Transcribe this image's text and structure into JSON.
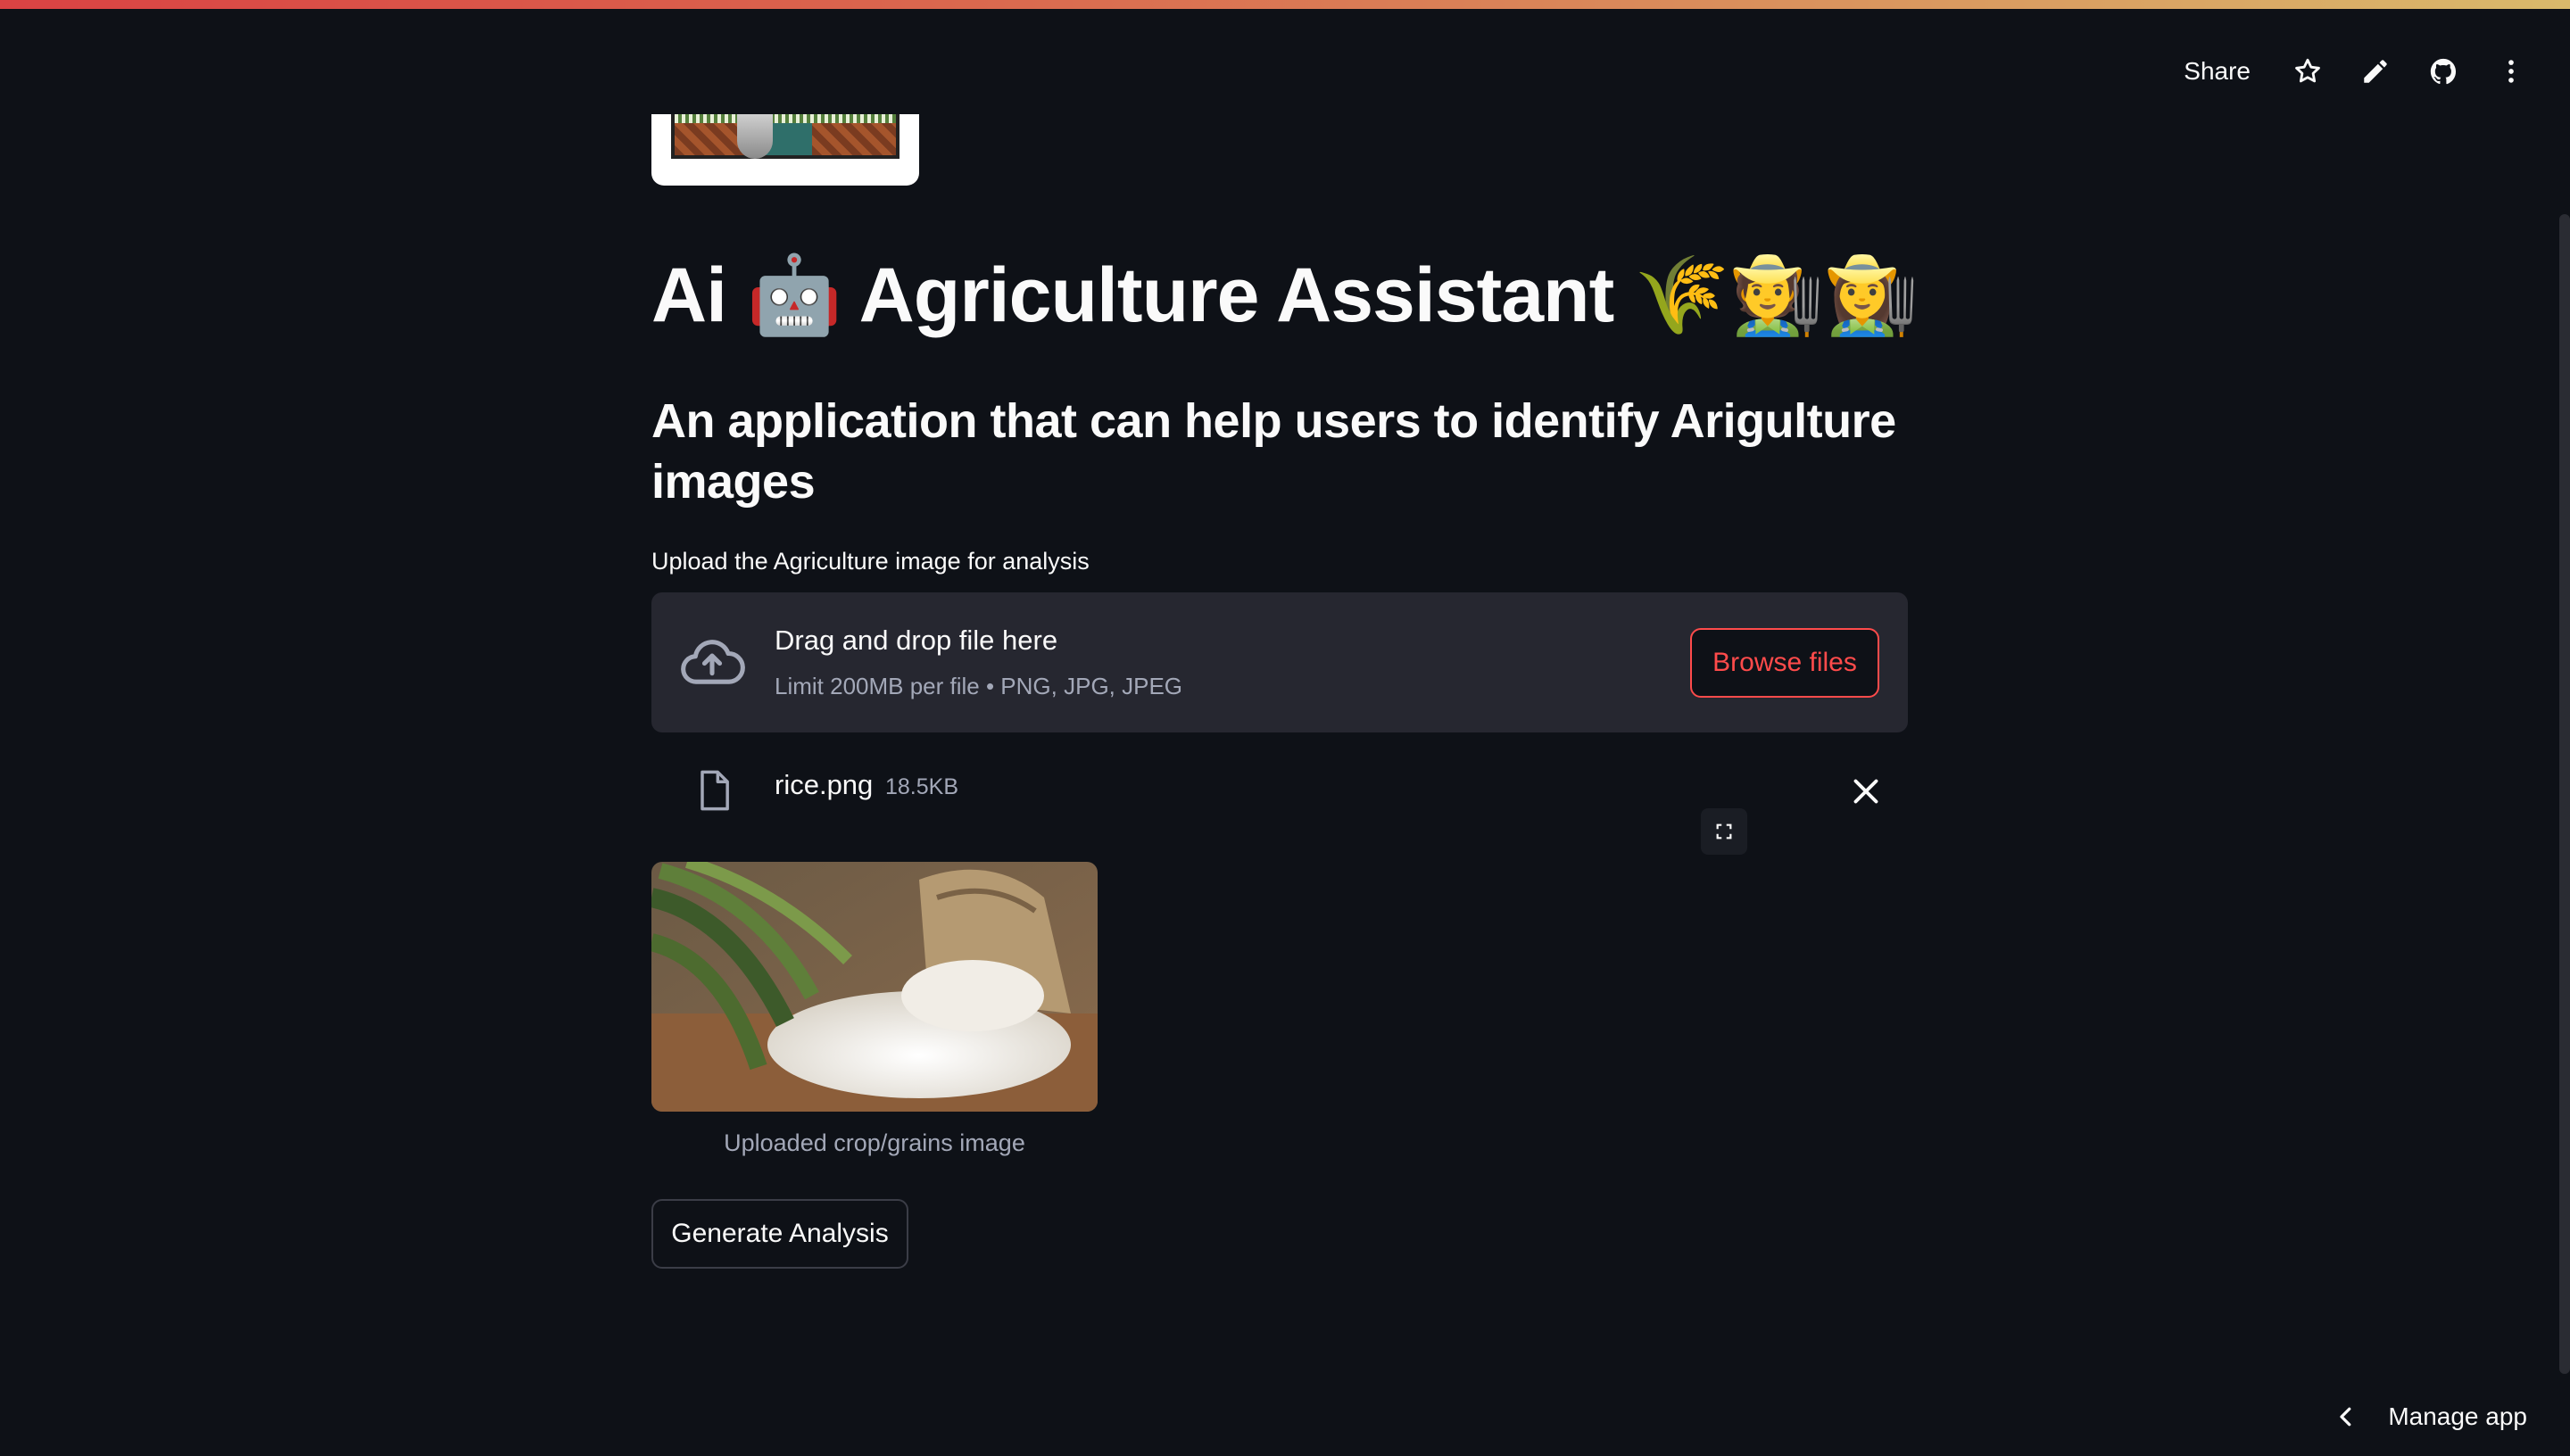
{
  "header": {
    "share_label": "Share",
    "icons": [
      "star-icon",
      "pencil-icon",
      "github-icon",
      "kebab-menu-icon"
    ]
  },
  "page": {
    "title": "Ai 🤖 Agriculture Assistant 🌾🧑‍🌾👩‍🌾",
    "subtitle": "An application that can help users to identify Arigulture images"
  },
  "uploader": {
    "label": "Upload the Agriculture image for analysis",
    "drop_title": "Drag and drop file here",
    "drop_limit": "Limit 200MB per file • PNG, JPG, JPEG",
    "browse_label": "Browse files",
    "file": {
      "name": "rice.png",
      "size": "18.5KB"
    }
  },
  "image": {
    "caption": "Uploaded crop/grains image"
  },
  "actions": {
    "generate_label": "Generate Analysis"
  },
  "footer": {
    "manage_label": "Manage app"
  },
  "colors": {
    "background": "#0e1117",
    "accent": "#ff4b4b",
    "surface": "#262730",
    "muted_text": "#a3a8b8"
  }
}
